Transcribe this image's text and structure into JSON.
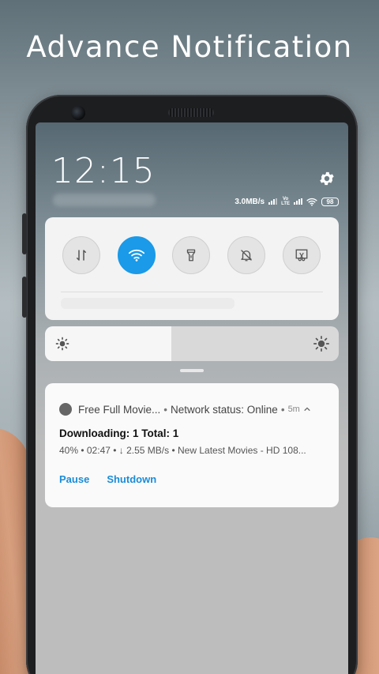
{
  "banner": {
    "title": "Advance Notification"
  },
  "status_bar": {
    "time": "12:15",
    "speed": "3.0MB/s",
    "volte": "Vo",
    "lte": "LTE",
    "battery": "98",
    "settings_icon": "gear-icon"
  },
  "quick_settings": {
    "toggles": [
      {
        "name": "data-transfer",
        "icon": "arrows-updown-icon",
        "active": false
      },
      {
        "name": "wifi",
        "icon": "wifi-icon",
        "active": true
      },
      {
        "name": "flashlight",
        "icon": "flashlight-icon",
        "active": false
      },
      {
        "name": "mute",
        "icon": "bell-off-icon",
        "active": false
      },
      {
        "name": "screenshot",
        "icon": "scissors-icon",
        "active": false
      }
    ],
    "brightness": 0.43
  },
  "notification": {
    "app_name": "Free Full Movie...",
    "header_status": "Network status: Online",
    "age": "5m",
    "title": "Downloading: 1 Total: 1",
    "detail": "40% • 02:47 • ↓ 2.55 MB/s • New Latest Movies - HD 108...",
    "actions": [
      "Pause",
      "Shutdown"
    ]
  },
  "colors": {
    "accent": "#1a9ae8",
    "action_text": "#1a8cd8",
    "panel": "#f3f3f3"
  }
}
